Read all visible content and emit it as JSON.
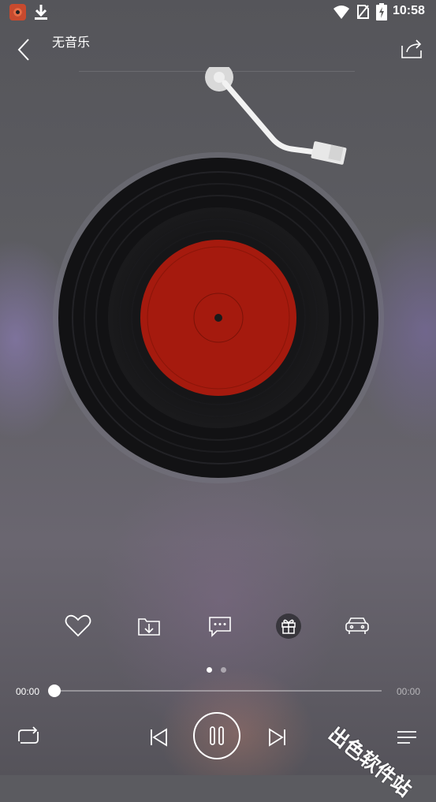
{
  "status_bar": {
    "time": "10:58",
    "icons": [
      "app-icon",
      "download-icon",
      "wifi-icon",
      "no-sim-icon",
      "battery-charging-icon"
    ]
  },
  "header": {
    "title": "无音乐",
    "back_icon": "chevron-left-icon",
    "share_icon": "share-icon"
  },
  "actions": [
    {
      "name": "favorite",
      "icon": "heart-icon"
    },
    {
      "name": "download",
      "icon": "folder-download-icon"
    },
    {
      "name": "comments",
      "icon": "comment-icon"
    },
    {
      "name": "gift",
      "icon": "gift-icon"
    },
    {
      "name": "car-mode",
      "icon": "car-icon"
    }
  ],
  "pager": {
    "count": 2,
    "active_index": 0
  },
  "progress": {
    "current": "00:00",
    "total": "00:00",
    "fraction": 0.0
  },
  "player": {
    "state": "playing",
    "icons": [
      "repeat-icon",
      "previous-icon",
      "pause-icon",
      "next-icon",
      "playlist-icon"
    ]
  },
  "colors": {
    "label_red": "#a51a0e",
    "record_black": "#121214",
    "accent_white": "#ffffff"
  },
  "watermark": "出色软件站"
}
